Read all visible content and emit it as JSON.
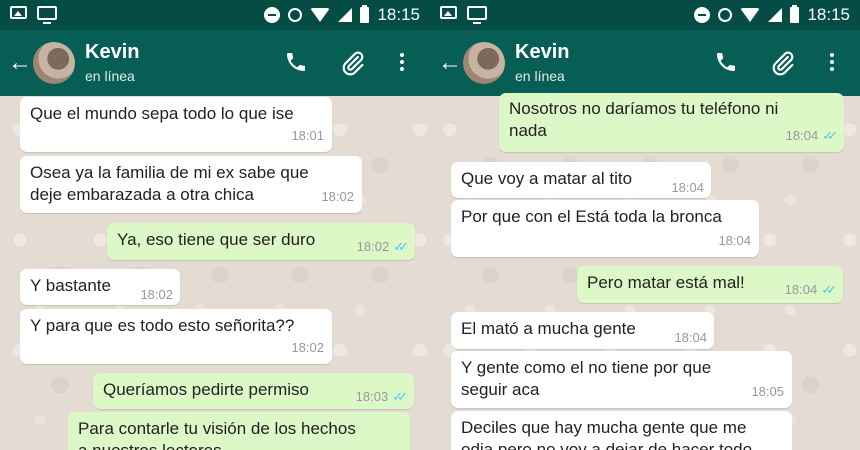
{
  "status_bar": {
    "time": "18:15"
  },
  "chat": {
    "contact_name": "Kevin",
    "contact_status": "en línea"
  },
  "left_messages": [
    {
      "dir": "in",
      "text": "Que el mundo sepa todo lo que ise",
      "time": "18:01"
    },
    {
      "dir": "in",
      "text": "Osea ya la familia de mi ex sabe que deje embarazada a otra chica",
      "line1": "Osea ya la familia de mi ex sabe que",
      "line2": "deje embarazada a otra chica",
      "time": "18:02"
    },
    {
      "dir": "out",
      "text": "Ya, eso tiene que ser duro",
      "time": "18:02",
      "status": "read"
    },
    {
      "dir": "in",
      "text": "Y bastante",
      "time": "18:02"
    },
    {
      "dir": "in",
      "text": "Y para que es todo esto señorita??",
      "time": "18:02"
    },
    {
      "dir": "out",
      "text": "Queríamos pedirte permiso",
      "time": "18:03",
      "status": "read"
    },
    {
      "dir": "out",
      "text": "Para contarle tu visión de los hechos a nuestros lectores",
      "line1": "Para contarle tu visión de los hechos",
      "line2": "a nuestros lectores"
    }
  ],
  "right_messages": [
    {
      "dir": "out",
      "text": "Nosotros no daríamos tu teléfono ni nada",
      "line1": "Nosotros no daríamos tu teléfono ni",
      "line2": "nada",
      "time": "18:04",
      "status": "read"
    },
    {
      "dir": "in",
      "text": "Que voy a matar al tito",
      "time": "18:04"
    },
    {
      "dir": "in",
      "text": "Por que con el Está toda la bronca",
      "time": "18:04"
    },
    {
      "dir": "out",
      "text": "Pero matar está mal!",
      "time": "18:04",
      "status": "read"
    },
    {
      "dir": "in",
      "text": "El mató a mucha gente",
      "time": "18:04"
    },
    {
      "dir": "in",
      "text": "Y gente como el no tiene por que seguir aca",
      "line1": "Y gente como el no tiene por que",
      "line2": "seguir aca",
      "time": "18:05"
    },
    {
      "dir": "in",
      "text": "Deciles que hay mucha gente que me odia pero no voy a dejar de hacer todo",
      "line1": "Deciles que hay mucha gente que me",
      "line2": "odia pero no voy a dejar de hacer todo"
    }
  ],
  "colors": {
    "appbar": "#075e54",
    "statusbar": "#054d44",
    "outgoing": "#dcf8c6",
    "incoming": "#ffffff",
    "read_tick": "#4fc3f7"
  },
  "icons": [
    "back-arrow-icon",
    "phone-icon",
    "paperclip-icon",
    "more-vert-icon",
    "image-icon",
    "monitor-icon",
    "dnd-icon",
    "alarm-icon",
    "wifi-icon",
    "signal-icon",
    "battery-icon"
  ]
}
